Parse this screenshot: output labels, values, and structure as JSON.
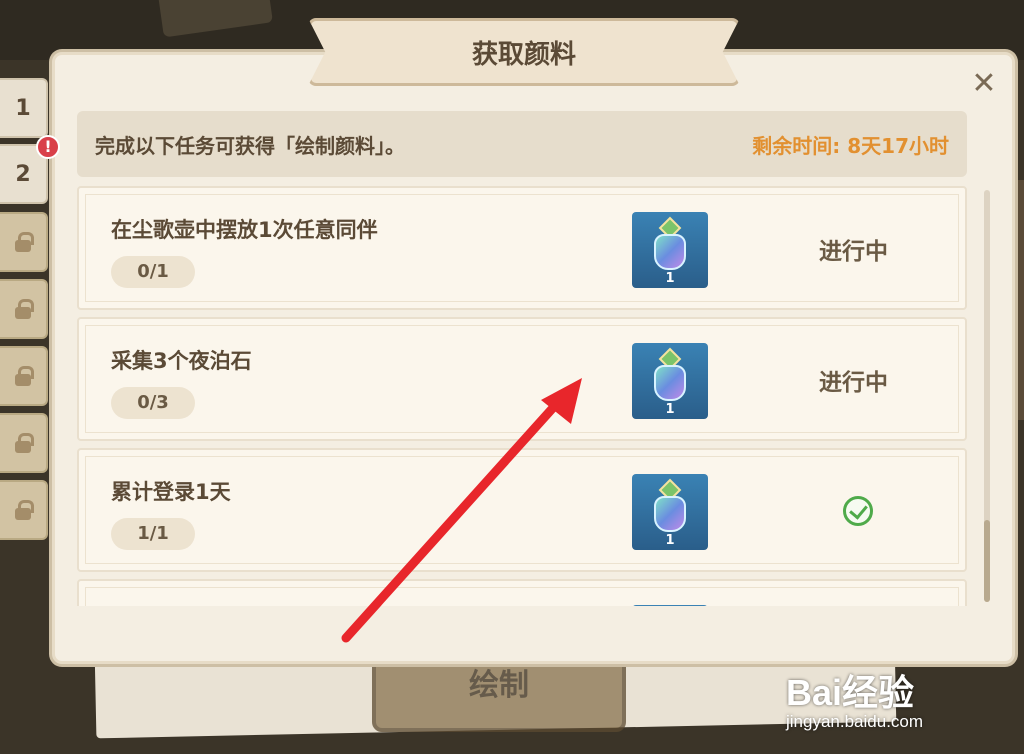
{
  "dialog": {
    "title": "获取颜料",
    "close_glyph": "✕"
  },
  "side_tabs": [
    {
      "label": "1",
      "locked": false
    },
    {
      "label": "2",
      "locked": false,
      "alert": "!"
    },
    {
      "label": "",
      "locked": true
    },
    {
      "label": "",
      "locked": true
    },
    {
      "label": "",
      "locked": true
    },
    {
      "label": "",
      "locked": true
    },
    {
      "label": "",
      "locked": true
    }
  ],
  "info": {
    "description": "完成以下任务可获得「绘制颜料」。",
    "time_label": "剩余时间: 8天17小时"
  },
  "tasks": [
    {
      "name": "在尘歌壶中摆放1次任意同伴",
      "progress": "0/1",
      "reward_count": "1",
      "status": "进行中"
    },
    {
      "name": "采集3个夜泊石",
      "progress": "0/3",
      "reward_count": "1",
      "status": "进行中"
    },
    {
      "name": "累计登录1天",
      "progress": "1/1",
      "reward_count": "1",
      "status": ""
    }
  ],
  "background": {
    "draw_button": "绘制"
  },
  "watermark": {
    "logo": "Bai经验",
    "url": "jingyan.baidu.com"
  },
  "colors": {
    "accent_time": "#e29030",
    "alert": "#d9404a",
    "complete": "#4faa4a",
    "annotation_arrow": "#e8262b"
  }
}
